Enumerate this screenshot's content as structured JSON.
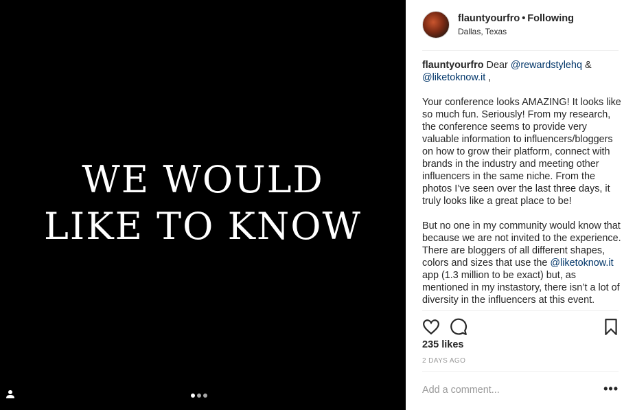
{
  "media": {
    "line1": "WE WOULD",
    "line2": "LIKE TO KNOW",
    "carousel_total": 3,
    "carousel_active": 1
  },
  "header": {
    "username": "flauntyourfro",
    "separator": "•",
    "follow_status": "Following",
    "location": "Dallas, Texas"
  },
  "caption": {
    "username": "flauntyourfro",
    "p1_text": "Dear ",
    "p1_mention1": "@rewardstylehq",
    "p1_mid": " & ",
    "p1_mention2": "@liketoknow.it",
    "p1_end": " ,",
    "p2": "Your conference looks AMAZING! It looks like so much fun. Seriously! From my research, the conference seems to provide very valuable information to influencers/bloggers on how to grow their platform, connect with brands in the industry and meeting other influencers in the same niche. From the photos I’ve seen over the last three days, it truly looks like a great place to be!",
    "p3_start": "But no one in my community would know that because we are not invited to the experience. There are bloggers of all different shapes, colors and sizes that use the ",
    "p3_mention": "@liketoknow.it",
    "p3_end": " app (1.3 million to be exact) but, as mentioned in my instastory, there isn’t a lot of diversity in the influencers at this event."
  },
  "stats": {
    "likes": "235 likes",
    "time": "2 DAYS AGO"
  },
  "comment_box": {
    "placeholder": "Add a comment...",
    "more": "•••"
  },
  "icons": {
    "like": "heart-icon",
    "comment": "comment-icon",
    "save": "bookmark-icon",
    "tag": "person-tag-icon"
  }
}
